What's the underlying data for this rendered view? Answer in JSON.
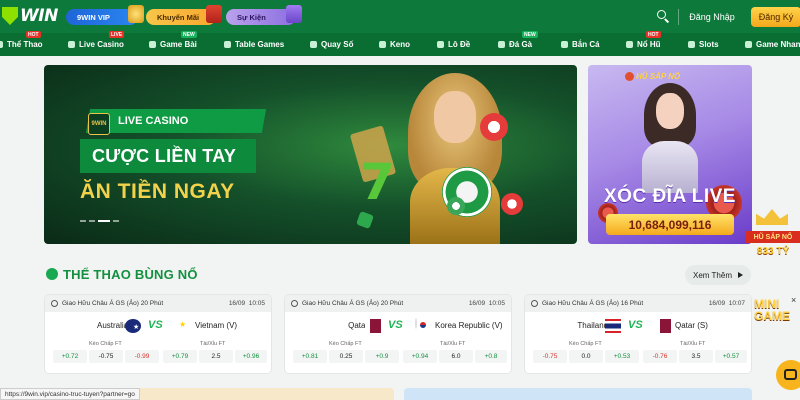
{
  "header": {
    "logo_text": "WIN",
    "pills": [
      {
        "label": "9WIN VIP"
      },
      {
        "label": "Khuyến Mãi"
      },
      {
        "label": "Sự Kiện"
      }
    ],
    "login_label": "Đăng Nhập",
    "register_label": "Đăng Ký"
  },
  "nav": {
    "items": [
      {
        "label": "Thể Thao",
        "badge": "HOT"
      },
      {
        "label": "Live Casino",
        "badge": "LIVE"
      },
      {
        "label": "Game Bài",
        "badge": "NEW"
      },
      {
        "label": "Table Games",
        "badge": ""
      },
      {
        "label": "Quay Số",
        "badge": ""
      },
      {
        "label": "Keno",
        "badge": ""
      },
      {
        "label": "Lô Đề",
        "badge": ""
      },
      {
        "label": "Đá Gà",
        "badge": "NEW"
      },
      {
        "label": "Bắn Cá",
        "badge": ""
      },
      {
        "label": "Nổ Hũ",
        "badge": "HOT"
      },
      {
        "label": "Slots",
        "badge": ""
      },
      {
        "label": "Game Nhanh",
        "badge": ""
      }
    ]
  },
  "main_banner": {
    "logo_text": "9WIN",
    "tag": "LIVE CASINO",
    "line1": "CƯỢC LIỀN TAY",
    "line2": "ĂN TIỀN NGAY"
  },
  "side_banner": {
    "jackpot_label": "HŨ SẮP NỔ",
    "title": "XÓC ĐĨA LIVE",
    "amount": "10,684,099,116"
  },
  "floating": {
    "jackpot_label": "HŨ SẮP NỔ",
    "jackpot_amount": "833 TỶ",
    "mini_game_label1": "MINI",
    "mini_game_label2": "GAME",
    "close_label": "×"
  },
  "sports": {
    "title": "THỂ THAO BÙNG NỔ",
    "see_more_label": "Xem Thêm",
    "matches": [
      {
        "league": "Giao Hữu Châu Á GS (Ảo) 20 Phút",
        "date": "16/09",
        "time": "10:05",
        "home": "Australia (V)",
        "away": "Vietnam (V)",
        "handicap_label": "Kèo Chấp FT",
        "over_under_label": "Tài/Xỉu FT",
        "odds": [
          "+0.72",
          "-0.75",
          "-0.99",
          "+0.79",
          "2.5",
          "+0.96"
        ]
      },
      {
        "league": "Giao Hữu Châu Á GS (Ảo) 20 Phút",
        "date": "16/09",
        "time": "10:05",
        "home": "Qatar (V)",
        "away": "Korea Republic (V)",
        "handicap_label": "Kèo Chấp FT",
        "over_under_label": "Tài/Xỉu FT",
        "odds": [
          "+0.81",
          "0.25",
          "+0.9",
          "+0.94",
          "6.0",
          "+0.8"
        ]
      },
      {
        "league": "Giao Hữu Châu Á GS (Ảo) 16 Phút",
        "date": "16/09",
        "time": "10:07",
        "home": "Thailand (S)",
        "away": "Qatar (S)",
        "handicap_label": "Kèo Chấp FT",
        "over_under_label": "Tài/Xỉu FT",
        "odds": [
          "-0.75",
          "0.0",
          "+0.53",
          "-0.76",
          "3.5",
          "+0.57"
        ]
      }
    ]
  },
  "status_url": "https://9win.vip/casino-truc-tuyen?partner=go",
  "colors": {
    "brand_green": "#0d7a3b",
    "accent_gold": "#f4a81c",
    "positive": "#13903f",
    "negative": "#d8332a"
  }
}
